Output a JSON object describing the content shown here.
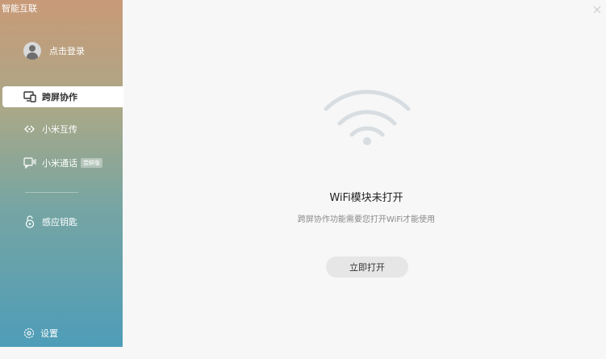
{
  "app": {
    "title": "智能互联"
  },
  "sidebar": {
    "login_label": "点击登录",
    "items": [
      {
        "label": "跨屏协作",
        "icon": "screen-collab-icon",
        "active": true
      },
      {
        "label": "小米互传",
        "icon": "transfer-icon",
        "active": false
      },
      {
        "label": "小米通话",
        "icon": "call-icon",
        "active": false,
        "badge": "尝鲜版"
      },
      {
        "label": "感应钥匙",
        "icon": "key-icon",
        "active": false
      }
    ],
    "settings_label": "设置"
  },
  "main": {
    "icon": "wifi-icon",
    "title": "WiFi模块未打开",
    "description": "跨屏协作功能需要您打开WiFi才能使用",
    "button_label": "立即打开"
  },
  "colors": {
    "sidebar_top": "#c99a78",
    "sidebar_bottom": "#4e9db8",
    "button_bg": "#e6e6e6",
    "wifi_icon": "#d7dde1"
  }
}
